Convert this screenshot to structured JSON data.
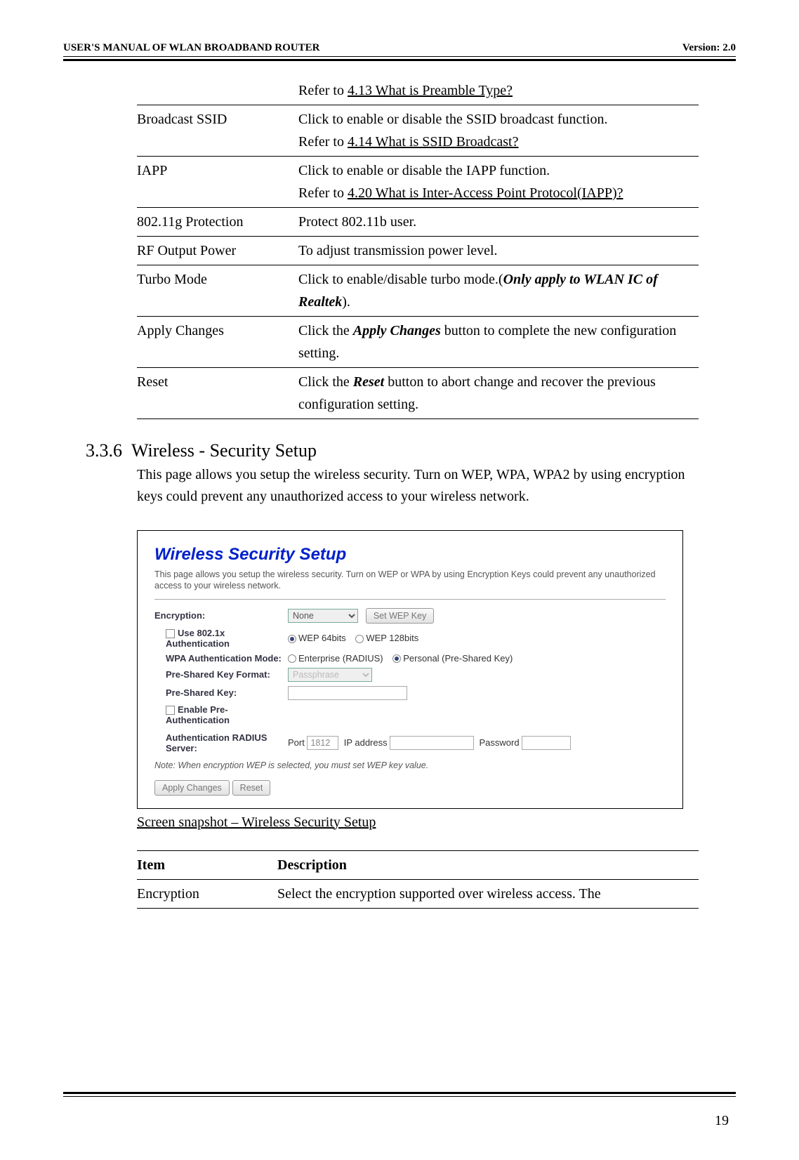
{
  "header": {
    "left": "USER'S MANUAL OF WLAN BROADBAND ROUTER",
    "right": "Version: 2.0"
  },
  "topTable": [
    {
      "item": "",
      "desc": "Refer to 4.13 What is Preamble Type?",
      "descLink": "4.13 What is Preamble Type?"
    },
    {
      "item": "Broadcast SSID",
      "desc1": "Click to enable or disable the SSID broadcast function.",
      "desc2pre": "Refer to ",
      "desc2link": "4.14 What is SSID Broadcast?"
    },
    {
      "item": "IAPP",
      "desc1": "Click to enable or disable the IAPP function.",
      "desc2pre": "Refer to ",
      "desc2link": "4.20 What is Inter-Access Point Protocol(IAPP)?"
    },
    {
      "item": "802.11g Protection",
      "desc1": "Protect 802.11b user."
    },
    {
      "item": "RF Output Power",
      "desc1": "To adjust transmission power level."
    },
    {
      "item": "Turbo Mode",
      "desc1pre": "Click to enable/disable turbo mode.(",
      "desc1ital": "Only apply to WLAN IC of Realtek",
      "desc1post": ")."
    },
    {
      "item": "Apply Changes",
      "desc1pre": "Click the ",
      "desc1ital": "Apply Changes",
      "desc1post": " button to complete the new configuration setting."
    },
    {
      "item": "Reset",
      "desc1pre": "Click the ",
      "desc1ital": "Reset",
      "desc1post": " button to abort change and recover the previous configuration setting."
    }
  ],
  "section": {
    "number": "3.3.6",
    "title": "Wireless - Security Setup",
    "intro": "This page allows you setup the wireless security. Turn on WEP, WPA, WPA2 by using encryption keys could prevent any unauthorized access to your wireless network."
  },
  "shot": {
    "title": "Wireless Security Setup",
    "desc": "This page allows you setup the wireless security. Turn on WEP or WPA by using Encryption Keys could prevent any unauthorized access to your wireless network.",
    "encryptionLabel": "Encryption:",
    "encryptionValue": "None",
    "setWep": "Set WEP Key",
    "use8021x": "Use 802.1x Authentication",
    "wep64": "WEP 64bits",
    "wep128": "WEP 128bits",
    "wpaMode": "WPA Authentication Mode:",
    "enterprise": "Enterprise (RADIUS)",
    "personal": "Personal (Pre-Shared Key)",
    "pskFormat": "Pre-Shared Key Format:",
    "pskFormatValue": "Passphrase",
    "psk": "Pre-Shared Key:",
    "preauth": "Enable Pre-Authentication",
    "radius": "Authentication RADIUS Server:",
    "port": "Port",
    "portValue": "1812",
    "ip": "IP address",
    "password": "Password",
    "note": "Note: When encryption WEP is selected, you must set WEP key value.",
    "apply": "Apply Changes",
    "reset": "Reset"
  },
  "caption": "Screen snapshot – Wireless Security Setup",
  "descTable": {
    "h1": "Item",
    "h2": "Description",
    "r1c1": "Encryption",
    "r1c2": "Select the encryption supported over wireless access. The"
  },
  "pageNumber": "19"
}
